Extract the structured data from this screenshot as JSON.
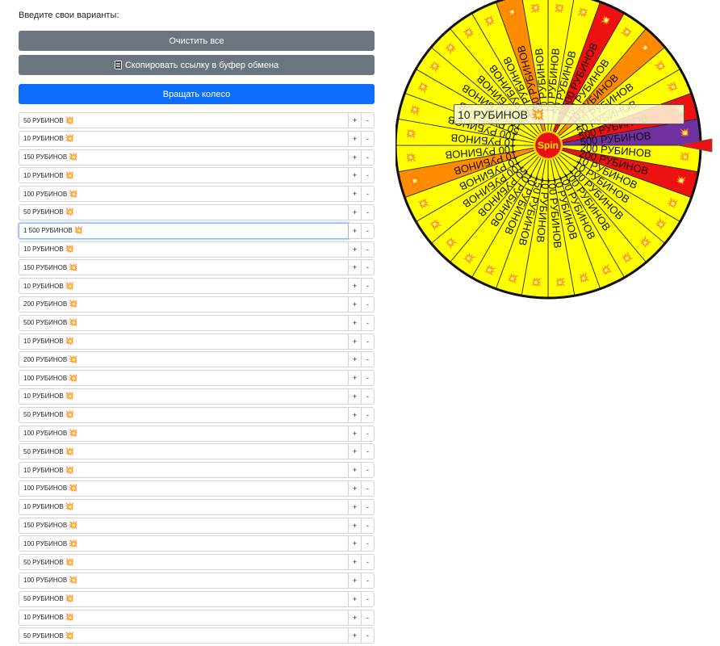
{
  "form": {
    "heading": "Введите свои варианты:",
    "clear_label": "Очистить все",
    "copy_label": "Скопировать ссылку в буфер обмена",
    "spin_label": "Вращать колесо",
    "plus_label": "+",
    "minus_label": "-",
    "star_glyph": "💥",
    "focused_index": 6
  },
  "options": [
    "50 РУБИНОВ",
    "10 РУБИНОВ",
    "150 РУБИНОВ",
    "10 РУБИНОВ",
    "100 РУБИНОВ",
    "50 РУБИНОВ",
    "1 500 РУБИНОВ",
    "10 РУБИНОВ",
    "150 РУБИНОВ",
    "10 РУБИНОВ",
    "200 РУБИНОВ",
    "500 РУБИНОВ",
    "10 РУБИНОВ",
    "200 РУБИНОВ",
    "100 РУБИНОВ",
    "10 РУБИНОВ",
    "50 РУБИНОВ",
    "100 РУБИНОВ",
    "50 РУБИНОВ",
    "10 РУБИНОВ",
    "100 РУБИНОВ",
    "10 РУБИНОВ",
    "150 РУБИНОВ",
    "100 РУБИНОВ",
    "50 РУБИНОВ",
    "100 РУБИНОВ",
    "50 РУБИНОВ",
    "10 РУБИНОВ",
    "50 РУБИНОВ"
  ],
  "wheel": {
    "center_label": "Spin",
    "current_label": "10 РУБИНОВ",
    "segment_count": 36,
    "colors": {
      "yellow": "#ffff00",
      "orange": "#ff8c00",
      "red": "#ee1111",
      "purple": "#7030a0",
      "hub": "#e81010",
      "pointer": "#ee1111"
    },
    "segments": [
      {
        "label": "10 РУБИНОВ",
        "color": "yellow"
      },
      {
        "label": "50 РУБИНОВ",
        "color": "yellow"
      },
      {
        "label": "1 500 РУБИНОВ",
        "color": "red"
      },
      {
        "label": "150 РУБИНОВ",
        "color": "yellow"
      },
      {
        "label": "10 РУБИНОВ",
        "color": "orange"
      },
      {
        "label": "150 РУБИНОВ",
        "color": "yellow"
      },
      {
        "label": "50 РУБИНОВ",
        "color": "yellow"
      },
      {
        "label": "500 РУБИНОВ",
        "color": "red"
      },
      {
        "label": "500 РУБИНОВ",
        "color": "purple"
      },
      {
        "label": "200 РУБИНОВ",
        "color": "yellow"
      },
      {
        "label": "200 РУБИНОВ",
        "color": "red"
      },
      {
        "label": "10 РУБИНОВ",
        "color": "yellow"
      },
      {
        "label": "10 РУБИНОВ",
        "color": "yellow"
      },
      {
        "label": "100 РУБИНОВ",
        "color": "yellow"
      },
      {
        "label": "100 РУБИНОВ",
        "color": "yellow"
      },
      {
        "label": "100 РУБИНОВ",
        "color": "yellow"
      },
      {
        "label": "10 РУБИНОВ",
        "color": "yellow"
      },
      {
        "label": "100 РУБИНОВ",
        "color": "yellow"
      },
      {
        "label": "10 РУБИНОВ",
        "color": "yellow"
      },
      {
        "label": "150 РУБИНОВ",
        "color": "yellow"
      },
      {
        "label": "10 РУБИНОВ",
        "color": "yellow"
      },
      {
        "label": "10 РУБИНОВ",
        "color": "yellow"
      },
      {
        "label": "50 РУБИНОВ",
        "color": "yellow"
      },
      {
        "label": "100 РУБИНОВ",
        "color": "yellow"
      },
      {
        "label": "10 РУБИНОВ",
        "color": "yellow"
      },
      {
        "label": "10 РУБИНОВ",
        "color": "orange"
      },
      {
        "label": "100 РУБИНОВ",
        "color": "yellow"
      },
      {
        "label": "10 РУБИНОВ",
        "color": "yellow"
      },
      {
        "label": "100 РУБИНОВ",
        "color": "yellow"
      },
      {
        "label": "50 РУБИНОВ",
        "color": "yellow"
      },
      {
        "label": "100 РУБИНОВ",
        "color": "yellow"
      },
      {
        "label": "50 РУБИНОВ",
        "color": "yellow"
      },
      {
        "label": "10 РУБИНОВ",
        "color": "yellow"
      },
      {
        "label": "50 РУБИНОВ",
        "color": "yellow"
      },
      {
        "label": "150 РУБИНОВ",
        "color": "orange"
      },
      {
        "label": "10 РУБИНОВ",
        "color": "yellow"
      }
    ]
  }
}
